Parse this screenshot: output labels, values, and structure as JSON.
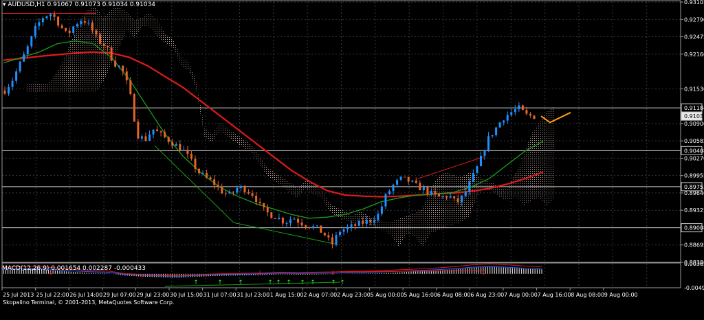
{
  "header": {
    "symbol_label": "▾ AUDUSD,H1",
    "ohlc": "0.91067 0.91073 0.91034 0.91034"
  },
  "indicator_header": "MACD(12,26,9) 0.001654 0.002287 -0.000433",
  "copyright": "Skopalino Terminal, © 2001-2013, MetaQuotes Software Corp.",
  "colors": {
    "background": "#000000",
    "grid": "#2f3a44",
    "bull_candle": "#1e90ff",
    "bear_candle": "#e8642a",
    "ma_slow": "#e01a1a",
    "ma_fast": "#1a9e1a",
    "cloud": "#d8b8a8",
    "forecast": "#ff9a1a",
    "macd_histogram": "#d0d0d0",
    "macd_signal": "#3a5aff",
    "macd_main": "#e01a1a",
    "macd_arrow_up": "#22ee22",
    "macd_arrow_down": "#ff2020"
  },
  "chart_data": [
    {
      "type": "candlestick",
      "symbol": "AUDUSD",
      "timeframe": "H1",
      "y_ticks": [
        "0.93105",
        "0.92790",
        "0.92475",
        "0.92160",
        "0.91530",
        "0.91184",
        "0.91034",
        "0.90900",
        "0.90585",
        "0.90408",
        "0.90270",
        "0.89955",
        "0.89753",
        "0.89640",
        "0.89325",
        "0.89008",
        "0.88695",
        "0.88380"
      ],
      "ylim": [
        0.8838,
        0.93105
      ],
      "price_levels": [
        0.91184,
        0.90408,
        0.89753,
        0.89008
      ],
      "current_price": 0.91034,
      "x_labels": [
        "25 Jul 2013",
        "25 Jul 22:00",
        "26 Jul 14:00",
        "29 Jul 07:00",
        "29 Jul 23:00",
        "30 Jul 15:00",
        "31 Jul 07:00",
        "31 Jul 23:00",
        "1 Aug 15:00",
        "2 Aug 07:00",
        "2 Aug 23:00",
        "5 Aug 00:00",
        "5 Aug 16:00",
        "6 Aug 08:00",
        "6 Aug 23:00",
        "7 Aug 00:00",
        "7 Aug 16:00",
        "8 Aug 08:00",
        "9 Aug 00:00"
      ],
      "price_path": [
        0.915,
        0.917,
        0.92,
        0.923,
        0.9265,
        0.9285,
        0.929,
        0.927,
        0.925,
        0.927,
        0.928,
        0.9265,
        0.924,
        0.923,
        0.92,
        0.919,
        0.915,
        0.907,
        0.906,
        0.908,
        0.907,
        0.906,
        0.905,
        0.904,
        0.902,
        0.9,
        0.899,
        0.898,
        0.8965,
        0.896,
        0.8975,
        0.897,
        0.896,
        0.8935,
        0.8925,
        0.892,
        0.891,
        0.892,
        0.891,
        0.8905,
        0.89,
        0.889,
        0.887,
        0.8895,
        0.89,
        0.8905,
        0.891,
        0.8915,
        0.8925,
        0.896,
        0.898,
        0.899,
        0.8985,
        0.8975,
        0.897,
        0.896,
        0.8955,
        0.896,
        0.8945,
        0.896,
        0.899,
        0.902,
        0.906,
        0.908,
        0.91,
        0.911,
        0.9118,
        0.9105,
        0.9103
      ],
      "moving_averages": [
        {
          "name": "MA slow",
          "color": "#e01a1a",
          "values": [
            0.9205,
            0.9208,
            0.9212,
            0.9215,
            0.9218,
            0.922,
            0.9218,
            0.921,
            0.9195,
            0.9175,
            0.9155,
            0.913,
            0.9105,
            0.908,
            0.9055,
            0.903,
            0.9005,
            0.8985,
            0.8968,
            0.896,
            0.8958,
            0.8957,
            0.8958,
            0.896,
            0.8962,
            0.8964,
            0.8967,
            0.8972,
            0.898,
            0.899,
            0.9002
          ]
        },
        {
          "name": "MA fast",
          "color": "#1a9e1a",
          "values": [
            0.92,
            0.921,
            0.922,
            0.9235,
            0.924,
            0.9235,
            0.921,
            0.917,
            0.912,
            0.907,
            0.903,
            0.9,
            0.8975,
            0.8958,
            0.8945,
            0.8935,
            0.8925,
            0.8918,
            0.892,
            0.8925,
            0.8935,
            0.8948,
            0.8955,
            0.896,
            0.8962,
            0.8965,
            0.8975,
            0.899,
            0.9015,
            0.904,
            0.9058
          ]
        }
      ],
      "forecast": {
        "color": "#ff9a1a",
        "values": [
          0.91034,
          0.9092,
          0.911
        ]
      }
    },
    {
      "type": "bar",
      "indicator": "MACD",
      "params": [
        12,
        26,
        9
      ],
      "values_printed": [
        "0.001654",
        "0.002287",
        "-0.000433"
      ],
      "y_ticks": [
        "0.003623",
        "-0.004953"
      ],
      "ylim": [
        -0.004953,
        0.003623
      ],
      "histogram": [
        0.0014,
        0.0016,
        0.0018,
        0.0012,
        0.0007,
        0.0004,
        0.0002,
        -0.0006,
        -0.001,
        -0.0012,
        -0.0014,
        -0.0011,
        -0.0008,
        -0.0006,
        -0.0005,
        -0.0004,
        -0.0002,
        -0.0003,
        -0.0002,
        -0.0001,
        0.0001,
        0.0002,
        0.0004,
        0.0006,
        0.0009,
        0.0012,
        0.0016,
        0.0022,
        0.0025,
        0.0022,
        0.0018,
        0.0016
      ]
    }
  ]
}
